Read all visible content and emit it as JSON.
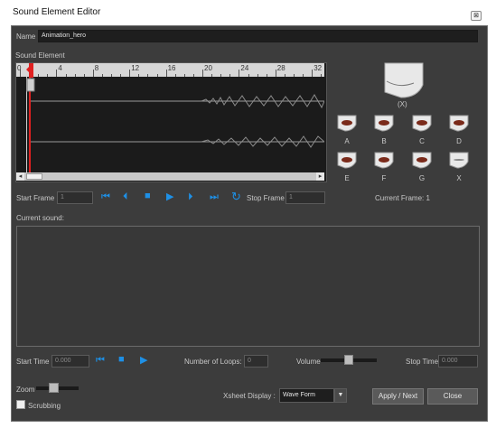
{
  "window": {
    "title": "Sound Element Editor",
    "close_icon": "close-icon"
  },
  "name": {
    "label": "Name",
    "value": "Animation_hero"
  },
  "sound_element": {
    "label": "Sound Element",
    "ruler_ticks": [
      "0",
      "4",
      "8",
      "12",
      "16",
      "20",
      "24",
      "28",
      "32"
    ]
  },
  "lipsync": {
    "preview_label": "(X)",
    "mouths": [
      "A",
      "B",
      "C",
      "D",
      "E",
      "F",
      "G",
      "X"
    ]
  },
  "frame_controls": {
    "start_frame_label": "Start Frame",
    "start_frame_value": "1",
    "stop_frame_label": "Stop Frame",
    "stop_frame_value": "1",
    "current_frame": "Current Frame: 1"
  },
  "current_sound": {
    "label": "Current sound:"
  },
  "time_controls": {
    "start_time_label": "Start Time",
    "start_time_value": "0.000",
    "loops_label": "Number of Loops:",
    "loops_value": "0",
    "volume_label": "Volume",
    "volume_level": 0.5,
    "stop_time_label": "Stop Time",
    "stop_time_value": "0.000"
  },
  "bottom": {
    "zoom_label": "Zoom",
    "scrubbing_label": "Scrubbing",
    "scrubbing_checked": false,
    "xsheet_label": "Xsheet Display :",
    "xsheet_value": "Wave Form",
    "apply_label": "Apply / Next",
    "close_label": "Close"
  },
  "colors": {
    "panel": "#3c3c3c",
    "accent": "#1e90e6",
    "playhead": "#e02020"
  }
}
